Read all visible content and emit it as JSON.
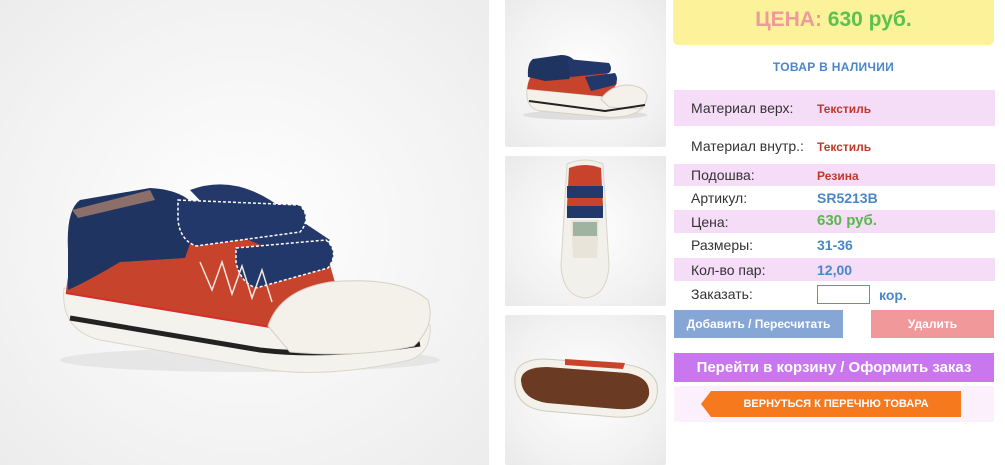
{
  "product": {
    "main_image": "child-sneaker-side-view",
    "thumbnails": [
      {
        "icon": "sneaker-side-thumbnail"
      },
      {
        "icon": "sneaker-top-thumbnail"
      },
      {
        "icon": "sneaker-sole-thumbnail"
      }
    ]
  },
  "price_box": {
    "label": "ЦЕНА:",
    "value": "630 руб."
  },
  "stock_status": "ТОВАР В НАЛИЧИИ",
  "specs": [
    {
      "label": "Материал верх:",
      "value": "Текстиль"
    },
    {
      "label": "Материал внутр.:",
      "value": "Текстиль"
    },
    {
      "label": "Подошва:",
      "value": "Резина"
    },
    {
      "label": "Артикул:",
      "value": "SR5213B"
    },
    {
      "label": "Цена:",
      "value": "630 руб."
    },
    {
      "label": "Размеры:",
      "value": "31-36"
    },
    {
      "label": "Кол-во пар:",
      "value": "12,00"
    }
  ],
  "order": {
    "label": "Заказать:",
    "quantity_value": "",
    "unit": "кор."
  },
  "buttons": {
    "add_recalc": "Добавить / Пересчитать",
    "delete": "Удалить",
    "go_to_cart": "Перейти в корзину / Оформить заказ",
    "back_to_list": "ВЕРНУТЬСЯ К ПЕРЕЧНЮ ТОВАРА"
  },
  "colors": {
    "price_bg": "#fbf29a",
    "price_label": "#ef9a9a",
    "price_value": "#5cc14f",
    "row_shade": "#f5dcf7",
    "add_button": "#86a6d6",
    "delete_button": "#f0989a",
    "cart_button": "#c977ee",
    "back_button": "#f7791e"
  }
}
